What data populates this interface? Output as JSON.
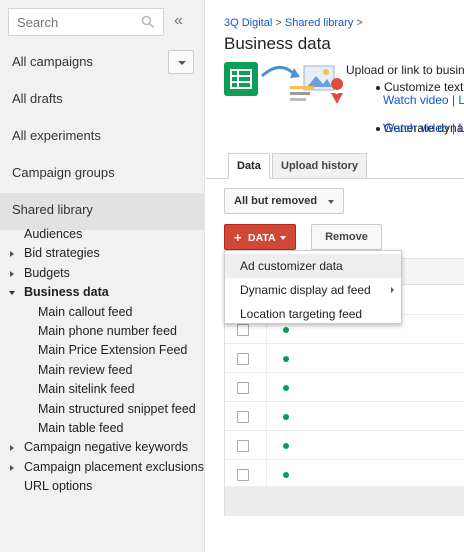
{
  "sidebar": {
    "search_placeholder": "Search",
    "collapse_glyph": "«",
    "nav": [
      {
        "label": "All campaigns",
        "has_dropdown": true
      },
      {
        "label": "All drafts"
      },
      {
        "label": "All experiments"
      },
      {
        "label": "Campaign groups"
      },
      {
        "label": "Shared library",
        "active": true
      }
    ],
    "tree": [
      {
        "label": "Audiences",
        "level": 1
      },
      {
        "label": "Bid strategies",
        "level": 1,
        "arrow": "right"
      },
      {
        "label": "Budgets",
        "level": 1,
        "arrow": "right"
      },
      {
        "label": "Business data",
        "level": 1,
        "arrow": "down",
        "bold": true
      },
      {
        "label": "Main callout feed",
        "level": 2
      },
      {
        "label": "Main phone number feed",
        "level": 2
      },
      {
        "label": "Main Price Extension Feed",
        "level": 2
      },
      {
        "label": "Main review feed",
        "level": 2
      },
      {
        "label": "Main sitelink feed",
        "level": 2
      },
      {
        "label": "Main structured snippet feed",
        "level": 2
      },
      {
        "label": "Main table feed",
        "level": 2
      },
      {
        "label": "Campaign negative keywords",
        "level": 1,
        "arrow": "right"
      },
      {
        "label": "Campaign placement exclusions",
        "level": 1,
        "arrow": "right"
      },
      {
        "label": "URL options",
        "level": 1
      }
    ]
  },
  "main": {
    "breadcrumb": {
      "account": "3Q Digital",
      "sep": ">",
      "section": "Shared library",
      "trail": ">"
    },
    "title": "Business data",
    "promo": {
      "intro": "Upload or link to busin",
      "bullet1": "Customize text",
      "watch1": "Watch video",
      "pipe1": "| L",
      "bullet2": "Generate dyna",
      "watch2": "Watch video",
      "pipe2": "| L"
    },
    "tabs": [
      {
        "label": "Data",
        "active": true
      },
      {
        "label": "Upload history"
      }
    ],
    "filter_label": "All but removed",
    "data_button": {
      "plus": "+",
      "label": "DATA"
    },
    "remove_label": "Remove",
    "dropdown": [
      {
        "label": "Ad customizer data",
        "hover": true
      },
      {
        "label": "Dynamic display ad feed",
        "submenu": true
      },
      {
        "label": "Location targeting feed"
      }
    ],
    "row_count": 7,
    "status_color": "#0b9d58",
    "accent_red": "#d14836",
    "link_color": "#1155cc"
  }
}
